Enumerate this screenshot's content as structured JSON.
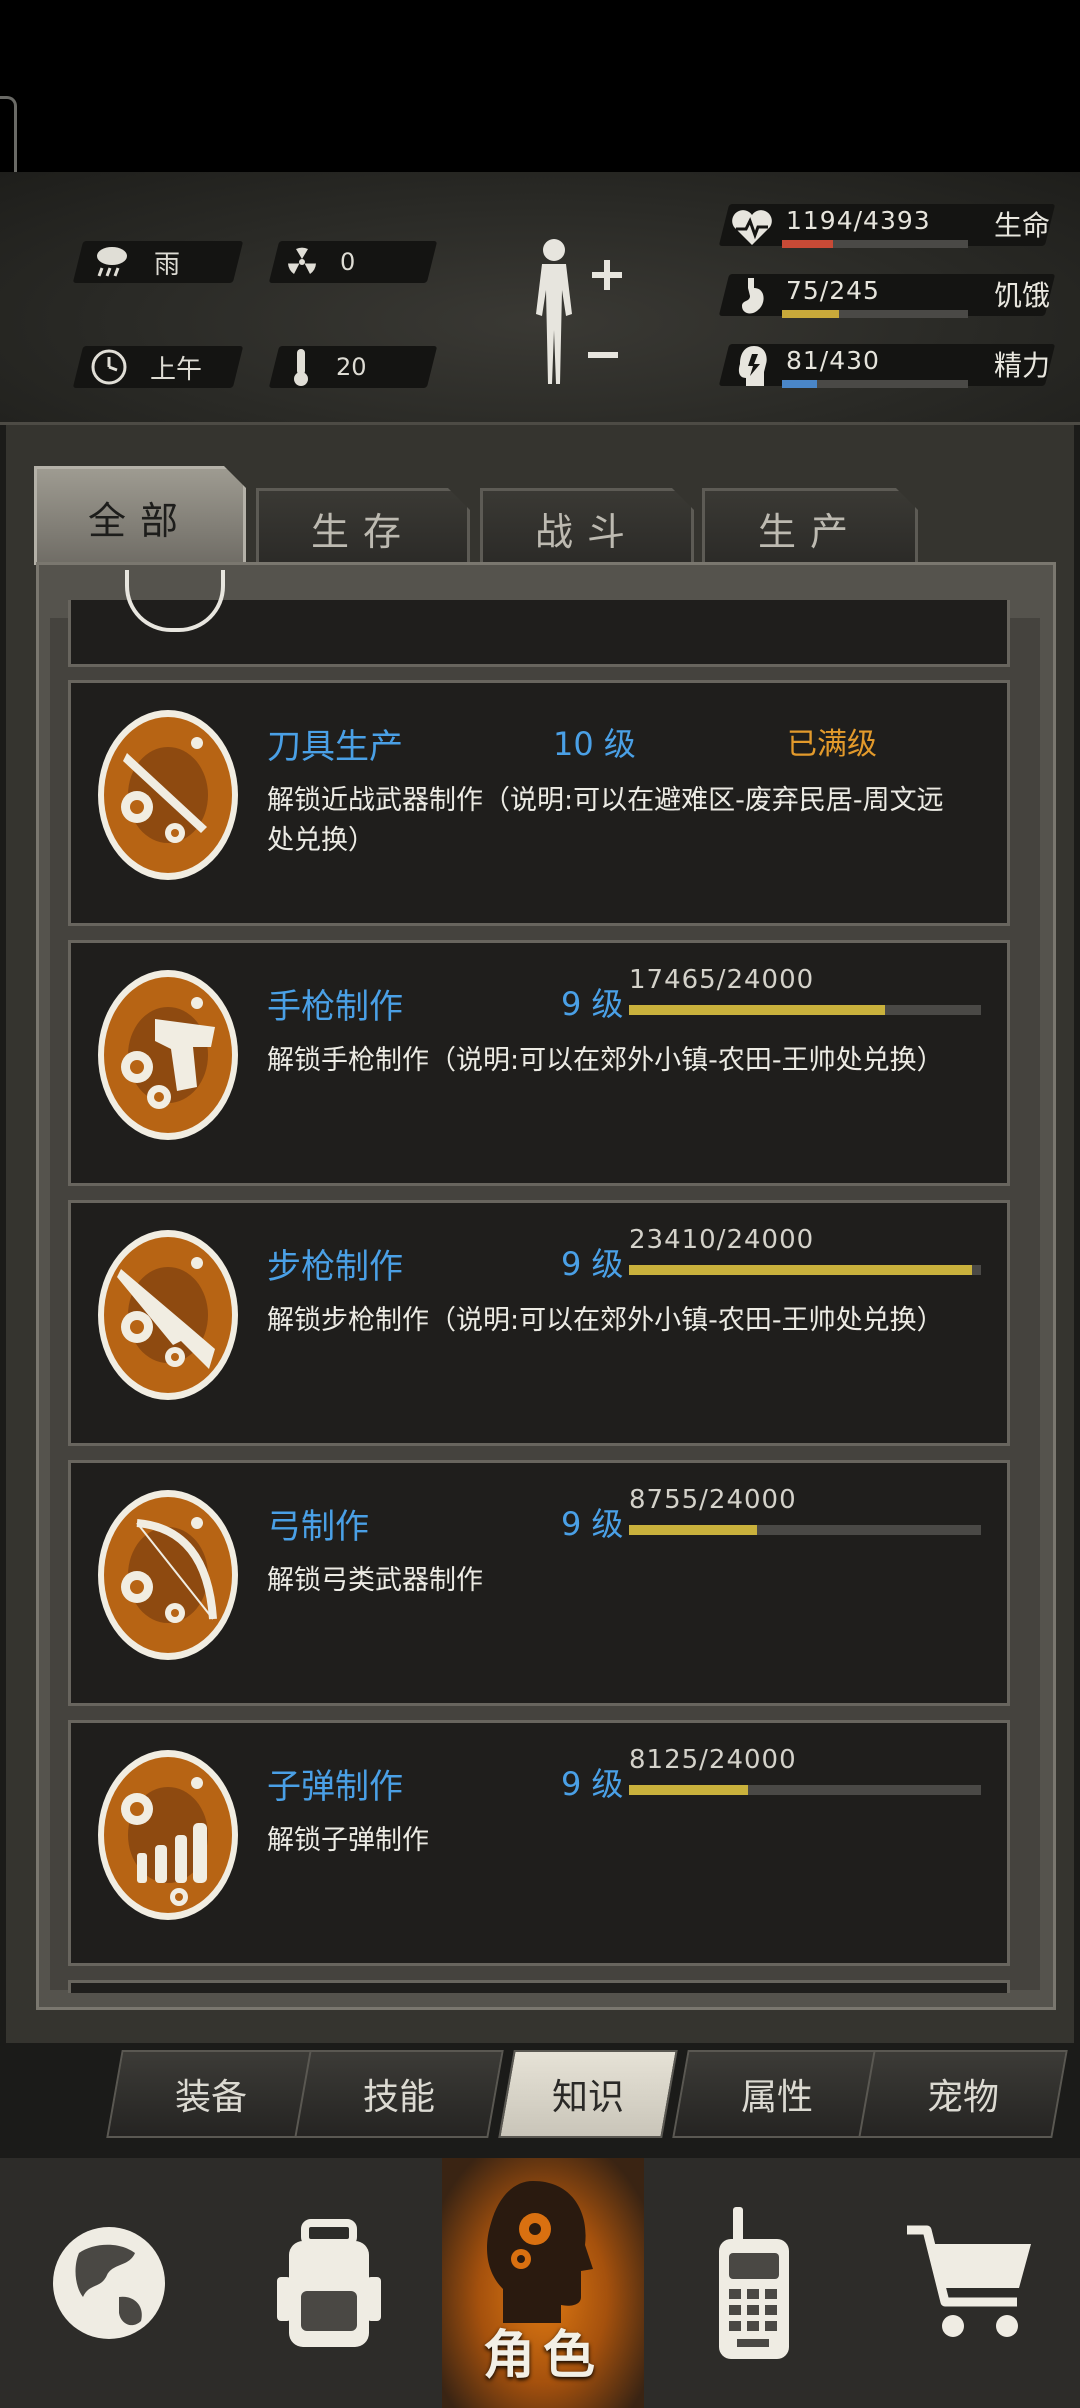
{
  "status": {
    "weather": {
      "icon": "rain-cloud-icon",
      "label": "雨"
    },
    "radiation": {
      "icon": "radiation-icon",
      "value": "0"
    },
    "time": {
      "icon": "clock-icon",
      "label": "上午"
    },
    "temperature": {
      "icon": "thermometer-icon",
      "value": "20"
    },
    "stats": [
      {
        "name": "health",
        "icon": "heart-icon",
        "text": "1194/4393",
        "label": "生命",
        "fraction": 0.272,
        "color": "#c84a36"
      },
      {
        "name": "hunger",
        "icon": "stomach-icon",
        "text": "75/245",
        "label": "饥饿",
        "fraction": 0.306,
        "color": "#c9a93a"
      },
      {
        "name": "energy",
        "icon": "brain-icon",
        "text": "81/430",
        "label": "精力",
        "fraction": 0.188,
        "color": "#4a86c8"
      }
    ]
  },
  "tabs": [
    {
      "label": "全部",
      "active": true
    },
    {
      "label": "生存",
      "active": false
    },
    {
      "label": "战斗",
      "active": false
    },
    {
      "label": "生产",
      "active": false
    }
  ],
  "skills": [
    {
      "name": "刀具生产",
      "level": "10 级",
      "maxed_text": "已满级",
      "desc": "解锁近战武器制作（说明:可以在避难区-废弃民居-周文远处兑换）",
      "icon": "knife-gear-icon"
    },
    {
      "name": "手枪制作",
      "level": "9 级",
      "xp": "17465/24000",
      "fraction": 0.7277,
      "desc": "解锁手枪制作（说明:可以在郊外小镇-农田-王帅处兑换）",
      "icon": "pistol-gear-icon"
    },
    {
      "name": "步枪制作",
      "level": "9 级",
      "xp": "23410/24000",
      "fraction": 0.9754,
      "desc": "解锁步枪制作（说明:可以在郊外小镇-农田-王帅处兑换）",
      "icon": "rifle-gear-icon"
    },
    {
      "name": "弓制作",
      "level": "9 级",
      "xp": "8755/24000",
      "fraction": 0.3648,
      "desc": "解锁弓类武器制作",
      "icon": "bow-gear-icon"
    },
    {
      "name": "子弹制作",
      "level": "9 级",
      "xp": "8125/24000",
      "fraction": 0.3385,
      "desc": "解锁子弹制作",
      "icon": "bullets-gear-icon"
    }
  ],
  "subnav": [
    {
      "label": "装备",
      "active": false
    },
    {
      "label": "技能",
      "active": false
    },
    {
      "label": "知识",
      "active": true
    },
    {
      "label": "属性",
      "active": false
    },
    {
      "label": "宠物",
      "active": false
    }
  ],
  "bottomnav": [
    {
      "name": "world",
      "icon": "globe-icon"
    },
    {
      "name": "backpack",
      "icon": "backpack-icon"
    },
    {
      "name": "character",
      "icon": "head-gears-icon",
      "label": "角色",
      "active": true
    },
    {
      "name": "radio",
      "icon": "walkie-talkie-icon"
    },
    {
      "name": "shop",
      "icon": "shopping-cart-icon"
    }
  ]
}
